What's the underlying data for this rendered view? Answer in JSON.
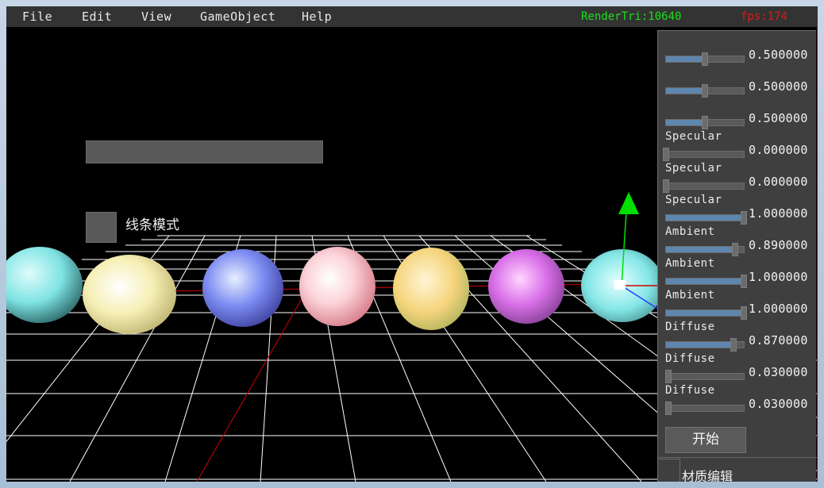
{
  "menu": [
    {
      "label": "File"
    },
    {
      "label": "Edit"
    },
    {
      "label": "View"
    },
    {
      "label": "GameObject"
    },
    {
      "label": "Help"
    }
  ],
  "stats": {
    "render_tri": "RenderTri:10640",
    "fps": "fps:174"
  },
  "overlay": {
    "line_mode_label": "线条模式"
  },
  "panel": {
    "sliders": [
      {
        "label": "",
        "value": "0.500000",
        "level": 0.5
      },
      {
        "label": "",
        "value": "0.500000",
        "level": 0.5
      },
      {
        "label": "",
        "value": "0.500000",
        "level": 0.5
      },
      {
        "label": "Specular",
        "value": "0.000000",
        "level": 0.0
      },
      {
        "label": "Specular",
        "value": "0.000000",
        "level": 0.0
      },
      {
        "label": "Specular",
        "value": "1.000000",
        "level": 1.0
      },
      {
        "label": "Ambient",
        "value": "0.890000",
        "level": 0.89
      },
      {
        "label": "Ambient",
        "value": "1.000000",
        "level": 1.0
      },
      {
        "label": "Ambient",
        "value": "1.000000",
        "level": 1.0
      },
      {
        "label": "Diffuse",
        "value": "0.870000",
        "level": 0.87
      },
      {
        "label": "Diffuse",
        "value": "0.030000",
        "level": 0.03
      },
      {
        "label": "Diffuse",
        "value": "0.030000",
        "level": 0.03
      }
    ],
    "start_label": "开始",
    "material_label": "材质编辑"
  },
  "colors": {
    "tri_text": "#18e018",
    "fps_text": "#e01818",
    "slider_fill": "#5e86ae",
    "gizmo_y": "#00e000",
    "gizmo_x": "#e00000",
    "gizmo_z": "#2040ff"
  },
  "spheres": [
    {
      "name": "cyan",
      "color": "#7fe3e3"
    },
    {
      "name": "cream",
      "color": "#f3eba0"
    },
    {
      "name": "periwinkle",
      "color": "#7d8df2"
    },
    {
      "name": "pink",
      "color": "#f49aa6"
    },
    {
      "name": "yellow",
      "color": "#f5d47c"
    },
    {
      "name": "violet",
      "color": "#d96fe8"
    },
    {
      "name": "aqua",
      "color": "#84e6e6"
    }
  ]
}
